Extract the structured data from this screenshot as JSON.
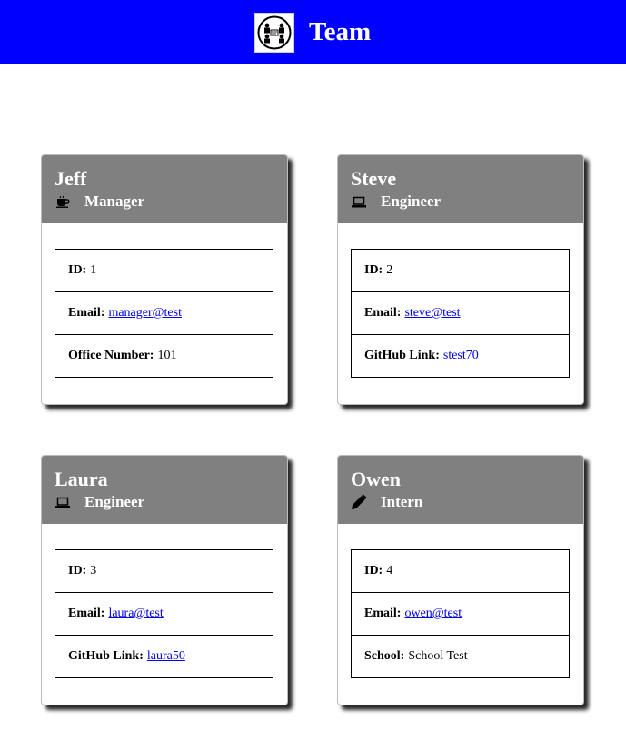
{
  "header": {
    "title": "Team",
    "logo_icon": "team-meeting-icon",
    "background": "#0000ff"
  },
  "cards": [
    {
      "name": "Jeff",
      "role": "Manager",
      "role_icon": "coffee-icon",
      "id_label": "ID:",
      "id": "1",
      "email_label": "Email:",
      "email": "manager@test",
      "extra_label": "Office Number:",
      "extra_value": "101"
    },
    {
      "name": "Steve",
      "role": "Engineer",
      "role_icon": "laptop-icon",
      "id_label": "ID:",
      "id": "2",
      "email_label": "Email:",
      "email": "steve@test",
      "extra_label": "GitHub Link:",
      "extra_value": "stest70"
    },
    {
      "name": "Laura",
      "role": "Engineer",
      "role_icon": "laptop-icon",
      "id_label": "ID:",
      "id": "3",
      "email_label": "Email:",
      "email": "laura@test",
      "extra_label": "GitHub Link:",
      "extra_value": "laura50"
    },
    {
      "name": "Owen",
      "role": "Intern",
      "role_icon": "pencil-icon",
      "id_label": "ID:",
      "id": "4",
      "email_label": "Email:",
      "email": "owen@test",
      "extra_label": "School:",
      "extra_value": "School Test"
    }
  ],
  "colors": {
    "card_header": "#808080",
    "link": "#0000ee"
  }
}
